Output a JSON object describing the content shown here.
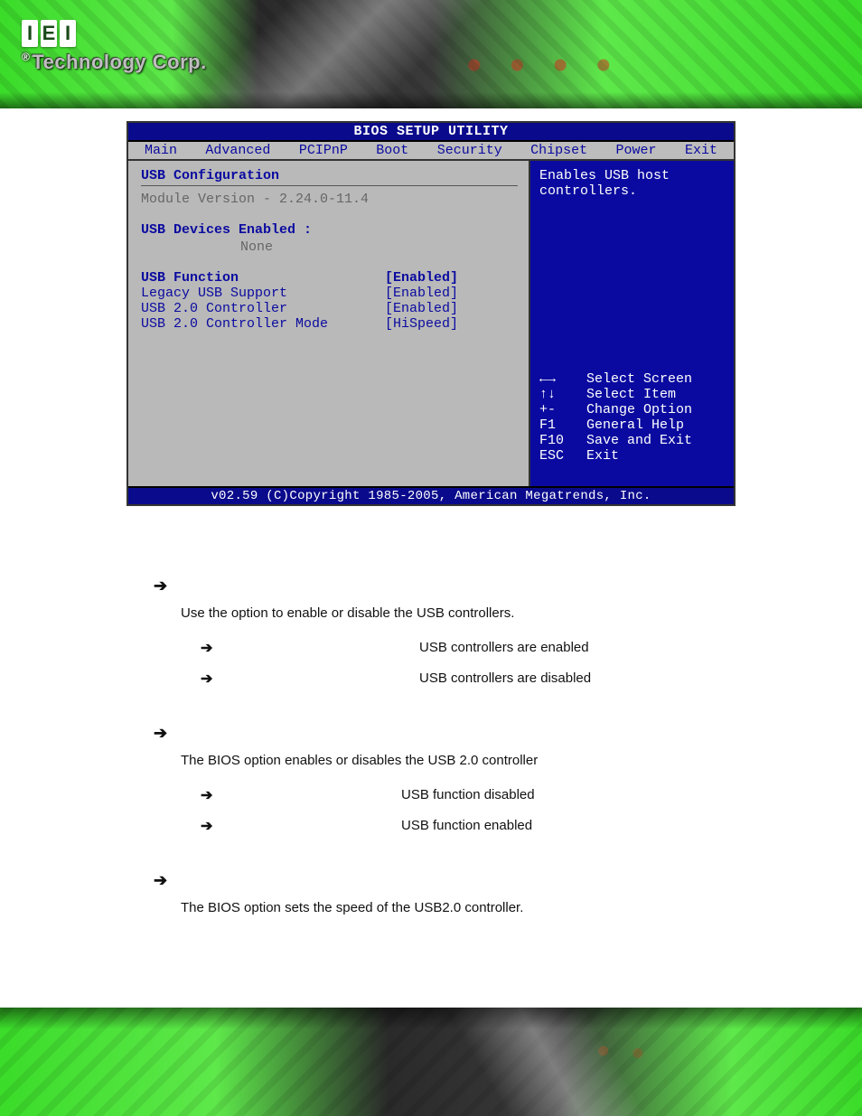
{
  "logo": {
    "r": "®",
    "tech": "Technology Corp."
  },
  "bios": {
    "title": "BIOS SETUP UTILITY",
    "menus": [
      "Main",
      "Advanced",
      "PCIPnP",
      "Boot",
      "Security",
      "Chipset",
      "Power",
      "Exit"
    ],
    "section": "USB Configuration",
    "module_line": "Module Version - 2.24.0-11.4",
    "devices_label": "USB Devices Enabled :",
    "devices_value": "None",
    "rows": [
      {
        "lbl": "USB Function",
        "val": "[Enabled]"
      },
      {
        "lbl": "Legacy USB Support",
        "val": "[Enabled]"
      },
      {
        "lbl": "USB 2.0 Controller",
        "val": "[Enabled]"
      },
      {
        "lbl": "USB 2.0 Controller Mode",
        "val": "[HiSpeed]"
      }
    ],
    "help_top": "Enables USB host controllers.",
    "help_keys": [
      {
        "k": "←→",
        "d": "Select Screen"
      },
      {
        "k": "↑↓",
        "d": "Select Item"
      },
      {
        "k": "+-",
        "d": "Change Option"
      },
      {
        "k": "F1",
        "d": "General Help"
      },
      {
        "k": "F10",
        "d": "Save and Exit"
      },
      {
        "k": "ESC",
        "d": "Exit"
      }
    ],
    "footer": "v02.59 (C)Copyright 1985-2005, American Megatrends, Inc."
  },
  "doc": {
    "s1": {
      "para_pre": "Use the ",
      "para_post": " option to enable or disable the USB controllers.",
      "opts": [
        {
          "desc": "USB controllers are enabled"
        },
        {
          "desc": "USB controllers are disabled"
        }
      ]
    },
    "s2": {
      "para_pre": "The ",
      "para_post": " BIOS option enables or disables the USB 2.0 controller",
      "opts": [
        {
          "desc": "USB function disabled"
        },
        {
          "desc": "USB function enabled"
        }
      ]
    },
    "s3": {
      "para_pre": "The ",
      "para_post": " BIOS option sets the speed of the USB2.0 controller."
    }
  }
}
